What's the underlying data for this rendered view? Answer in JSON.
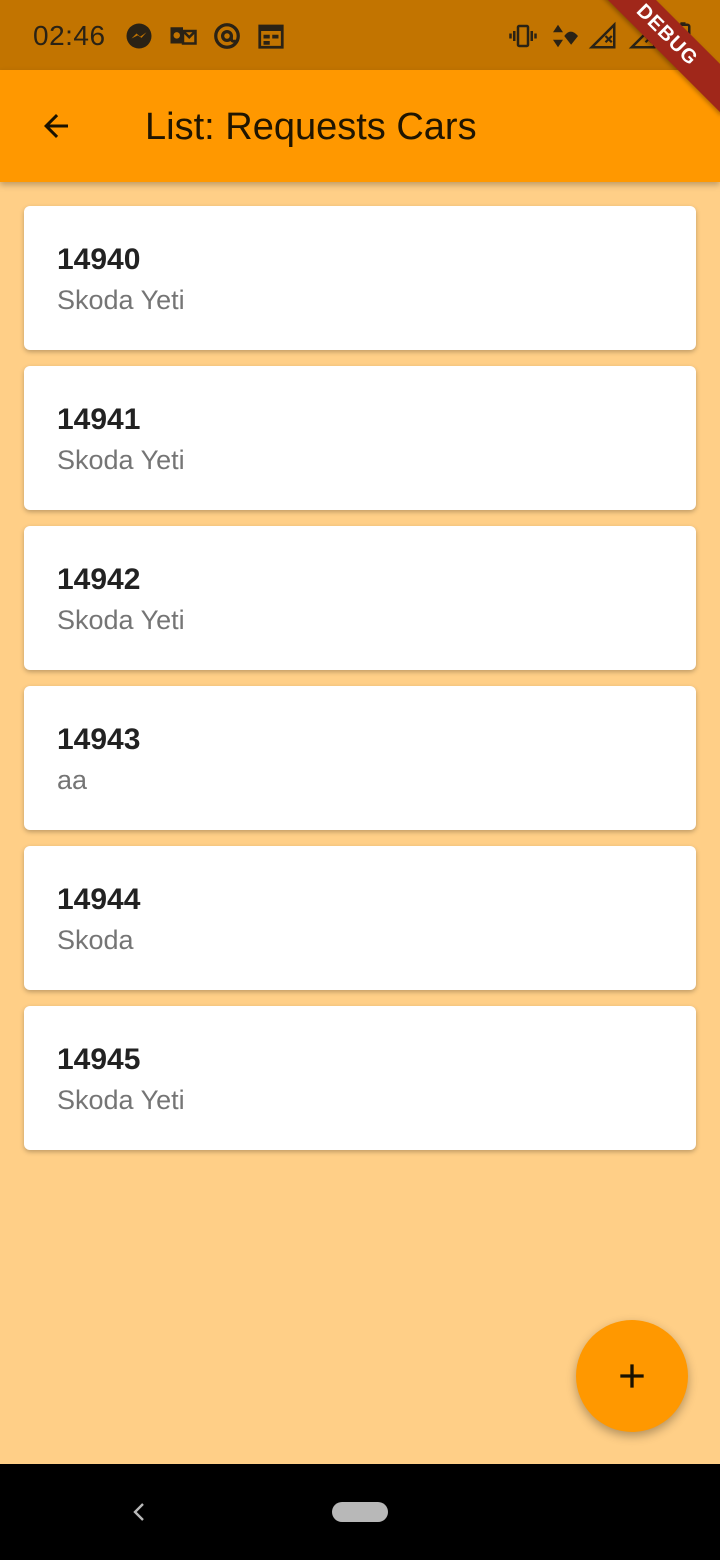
{
  "status_bar": {
    "time": "02:46",
    "left_icons": [
      "messenger-icon",
      "outlook-icon",
      "at-sign-icon",
      "calendar-icon"
    ],
    "right_icons": [
      "vibrate-icon",
      "data-arrows-icon",
      "wifi-icon",
      "signal-icon",
      "signal-2-icon",
      "battery-icon"
    ]
  },
  "debug_banner": {
    "label": "DEBUG"
  },
  "app_bar": {
    "back_icon": "arrow-back-icon",
    "title": "List: Requests Cars"
  },
  "requests": [
    {
      "id": "14940",
      "car": "Skoda Yeti"
    },
    {
      "id": "14941",
      "car": "Skoda Yeti"
    },
    {
      "id": "14942",
      "car": "Skoda Yeti"
    },
    {
      "id": "14943",
      "car": "aa"
    },
    {
      "id": "14944",
      "car": "Skoda"
    },
    {
      "id": "14945",
      "car": "Skoda Yeti"
    }
  ],
  "fab": {
    "icon": "plus-icon"
  },
  "nav_bar": {
    "back_icon": "nav-back-icon",
    "home_icon": "home-pill-icon"
  },
  "colors": {
    "status_bar": "#c27400",
    "app_bar": "#ff9800",
    "background": "#ffcf87",
    "card": "#ffffff",
    "fab": "#ff9800",
    "debug_banner": "#a0271a"
  }
}
